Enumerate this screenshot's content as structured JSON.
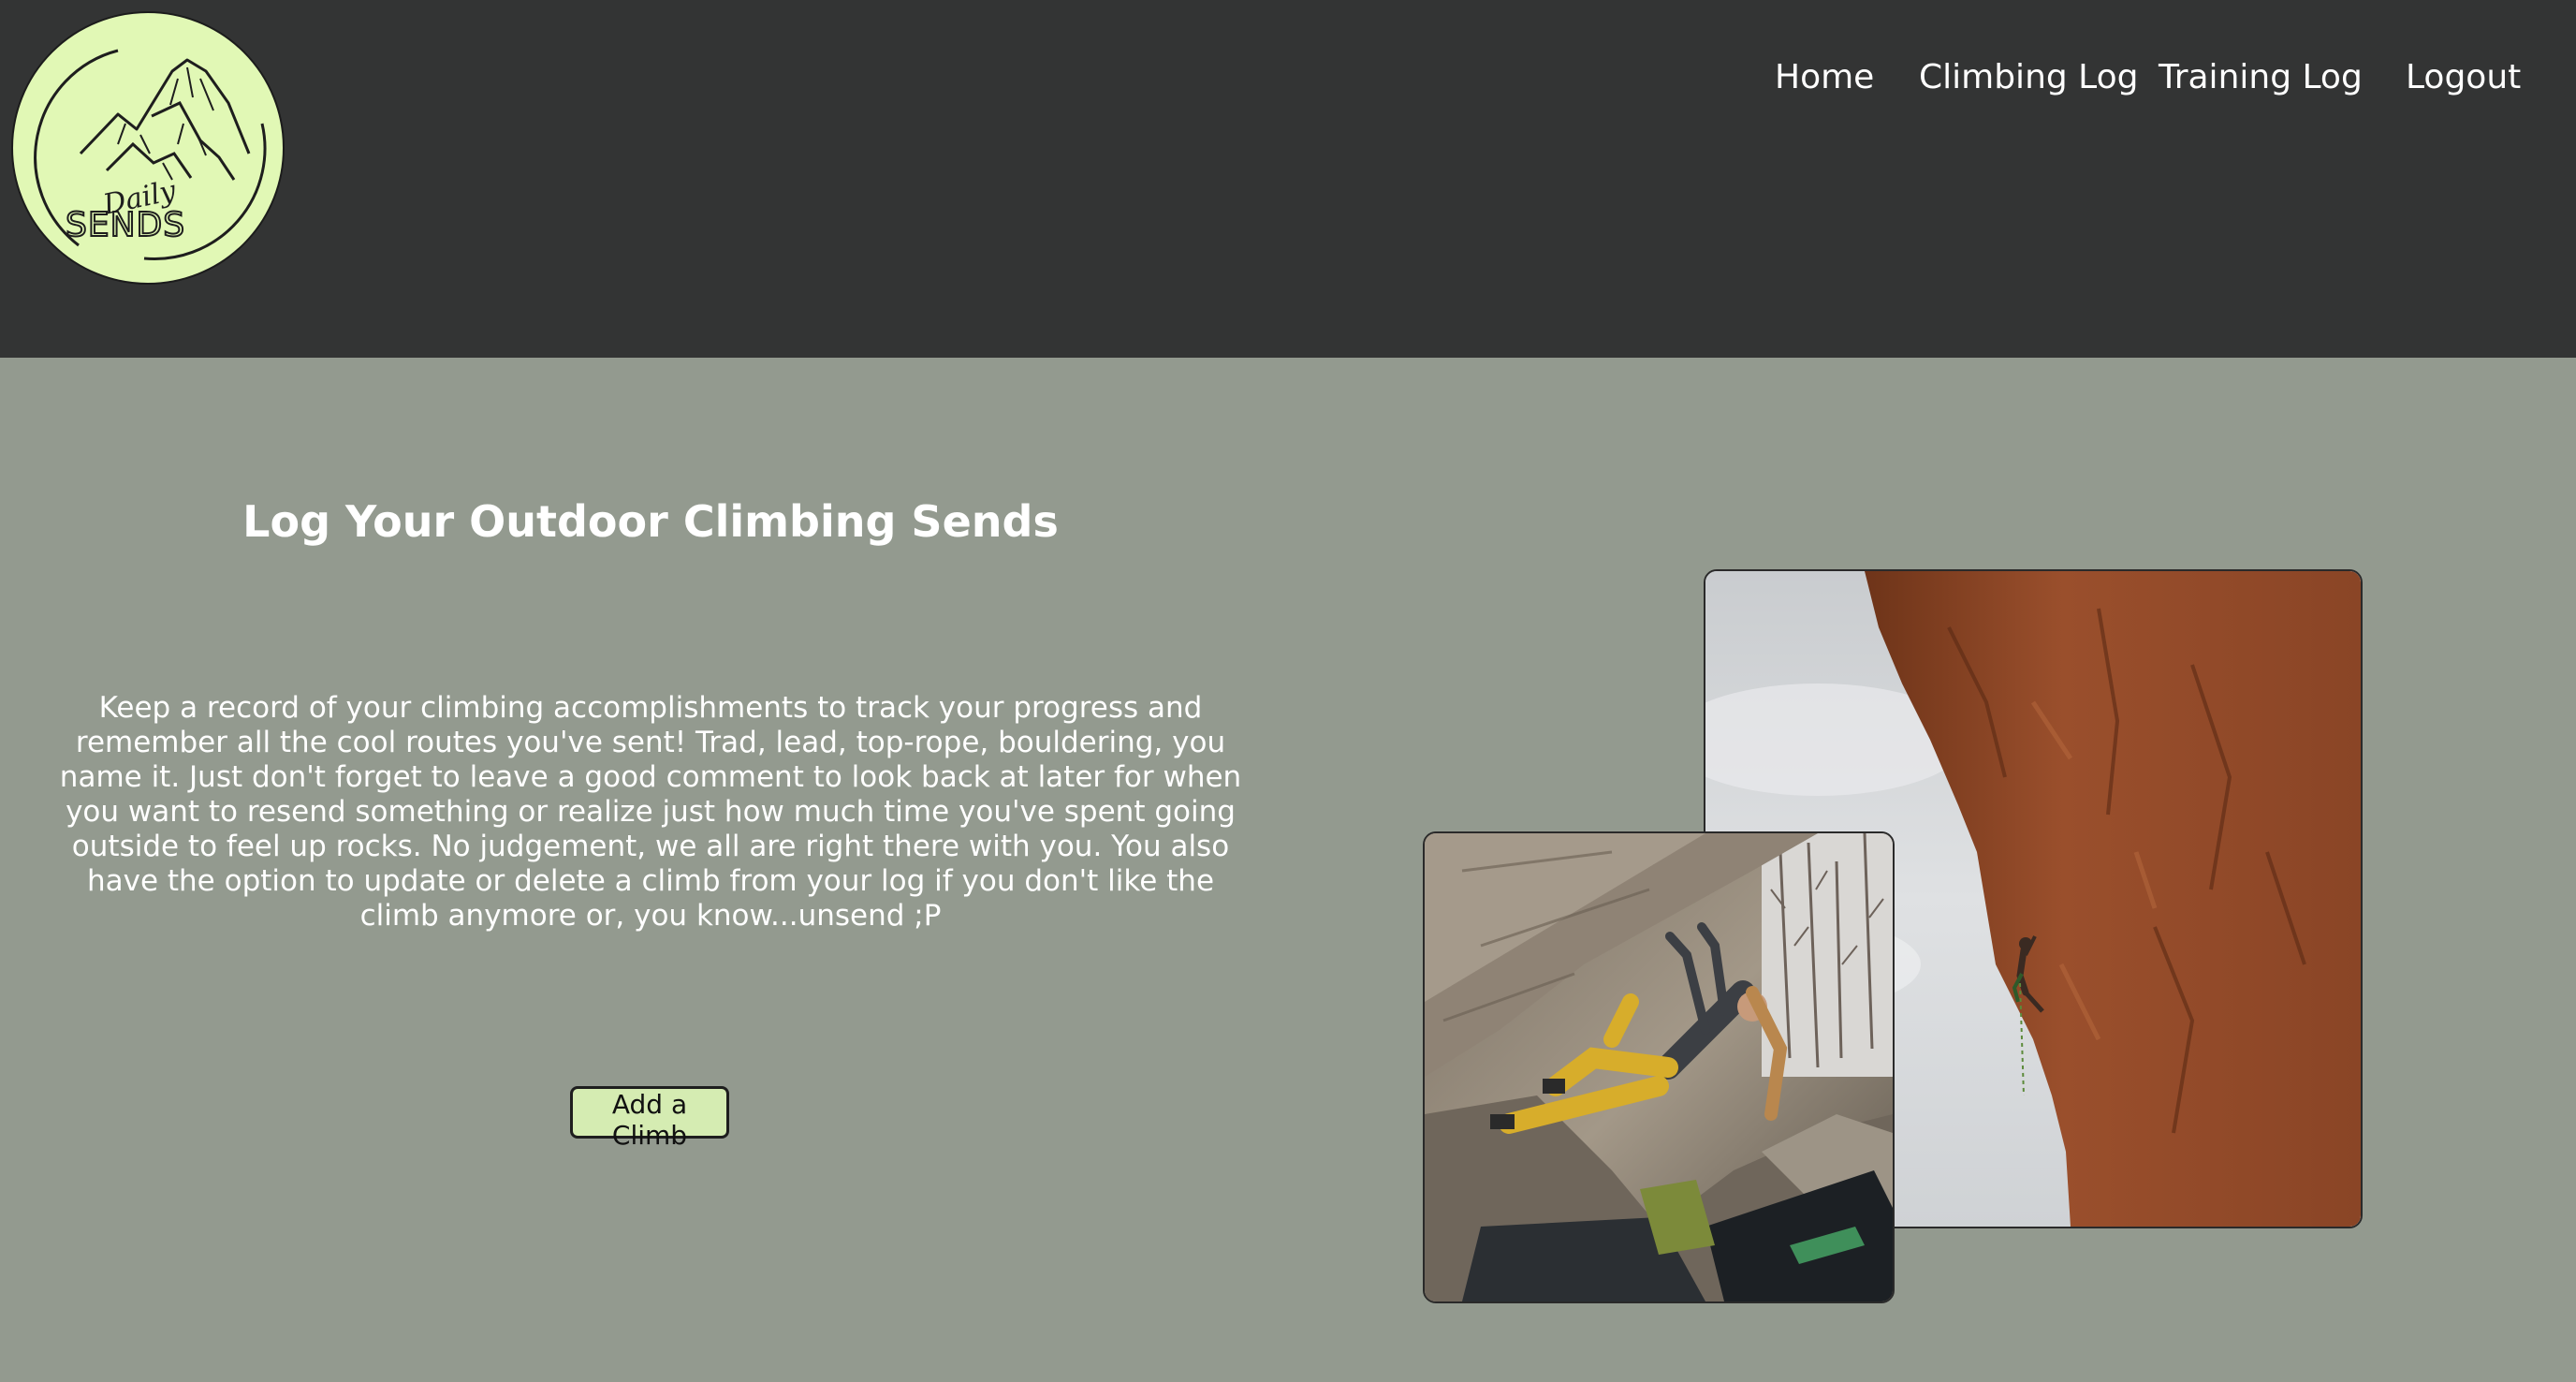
{
  "header": {
    "logo": {
      "line1": "Daily",
      "line2": "SENDS",
      "icon": "mountain-logo-icon"
    },
    "nav": [
      {
        "label": "Home"
      },
      {
        "label": "Climbing Log"
      },
      {
        "label": "Training Log"
      },
      {
        "label": "Logout"
      }
    ]
  },
  "main": {
    "title": "Log Your Outdoor Climbing Sends",
    "description": "Keep a record of your climbing accomplishments to track your progress and remember all the cool routes you've sent! Trad, lead, top-rope, bouldering, you name it. Just don't forget to leave a good comment to look back at later for when you want to resend something or realize just how much time you've spent going outside to feel up rocks. No judgement, we all are right there with you. You also have the option to update or delete a climb from your log if you don't like the climb anymore or, you know...unsend ;P",
    "add_button": "Add a Climb"
  },
  "colors": {
    "header_bg": "#333434",
    "page_bg": "#939a8f",
    "accent": "#e1f8b5",
    "button_bg": "#d5ecb2"
  }
}
